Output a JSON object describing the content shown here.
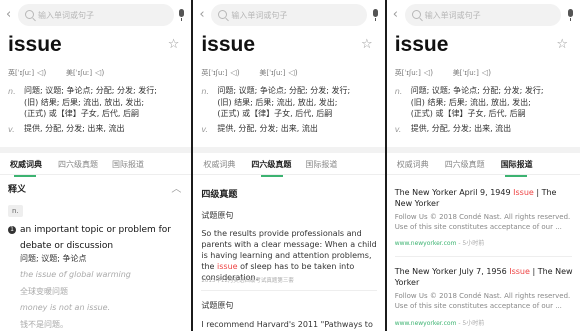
{
  "search": {
    "placeholder": "输入单词或句子"
  },
  "word": "issue",
  "phonetics": {
    "uk": "英[ˈɪʃuː]",
    "us": "美[ˈɪʃuː]"
  },
  "basic": [
    {
      "pos": "n.",
      "lines": [
        "问题; 议题; 争论点; 分配; 分发; 发行;",
        "(旧) 结果; 后果; 流出, 放出, 发出;",
        "(正式) 或【律】子女, 后代, 后嗣"
      ]
    },
    {
      "pos": "v.",
      "lines": [
        "提供, 分配, 分发; 出来, 流出"
      ]
    }
  ],
  "tabs": [
    "权威词典",
    "四六级真题",
    "国际报道"
  ],
  "panel1": {
    "section_title": "释义",
    "pos_badge": "n.",
    "sense_num": "1",
    "sense_en": "an important topic or problem for debate or discussion",
    "sense_cn": "问题; 议题; 争论点",
    "examples": [
      {
        "en": "the issue of global warming",
        "cn": "全球变暖问题"
      },
      {
        "en": "money is not an issue.",
        "cn": "钱不是问题。"
      }
    ]
  },
  "panel2": {
    "section_title": "四级真题",
    "sub1": "试题原句",
    "sentence_pre": "So the results provide professionals and parents with a clear message: When a child is having learning and attention problems, the ",
    "sentence_hl": "issue",
    "sentence_post": " of sleep has to be taken into consideration.",
    "source": "2013年12月英语四级考试真题第三套",
    "sub2": "试题原句",
    "sentence2": "I recommend Harvard's 2011 \"Pathways to"
  },
  "panel3": {
    "news": [
      {
        "pre": "The New Yorker April 9, 1949 ",
        "hl": "Issue",
        "post": " | The New Yorker",
        "body": "Follow Us © 2018 Condé Nast. All rights reserved. Use of this site constitutes acceptance of our ...",
        "site": "www.newyorker.com",
        "time": " - 5小时前"
      },
      {
        "pre": "The New Yorker July 7, 1956 ",
        "hl": "Issue",
        "post": " | The New Yorker",
        "body": "Follow Us © 2018 Condé Nast. All rights reserved. Use of this site constitutes acceptance of our ...",
        "site": "www.newyorker.com",
        "time": " - 5小时前"
      }
    ]
  },
  "colors": {
    "accent": "#3cb371",
    "highlight": "#e44444"
  },
  "icons": [
    "back-arrow-icon",
    "search-icon",
    "mic-icon",
    "star-icon",
    "speaker-icon",
    "chevron-up-icon"
  ]
}
